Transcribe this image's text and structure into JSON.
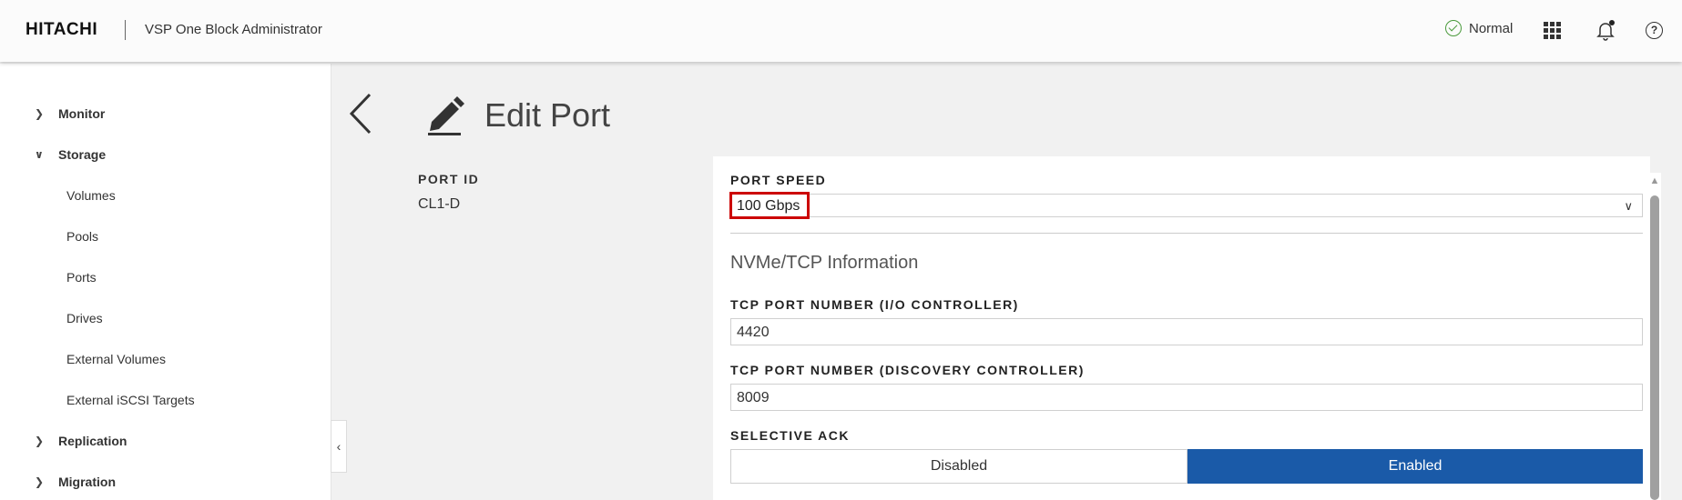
{
  "header": {
    "logo": "HITACHI",
    "app_title": "VSP One Block Administrator",
    "status": "Normal",
    "status_color": "#4a9a3c"
  },
  "sidebar": {
    "items": [
      {
        "label": "Monitor",
        "expanded": false
      },
      {
        "label": "Storage",
        "expanded": true
      },
      {
        "label": "Volumes"
      },
      {
        "label": "Pools"
      },
      {
        "label": "Ports"
      },
      {
        "label": "Drives"
      },
      {
        "label": "External Volumes"
      },
      {
        "label": "External iSCSI Targets"
      },
      {
        "label": "Replication",
        "expanded": false
      },
      {
        "label": "Migration",
        "expanded": false
      }
    ]
  },
  "page": {
    "title": "Edit Port"
  },
  "port": {
    "id_label": "PORT ID",
    "id_value": "CL1-D"
  },
  "form": {
    "port_speed_label": "PORT SPEED",
    "port_speed_value": "100 Gbps",
    "section_title": "NVMe/TCP Information",
    "tcp_io_label": "TCP PORT NUMBER (I/O CONTROLLER)",
    "tcp_io_value": "4420",
    "tcp_discovery_label": "TCP PORT NUMBER (DISCOVERY CONTROLLER)",
    "tcp_discovery_value": "8009",
    "selective_ack_label": "SELECTIVE ACK",
    "selective_ack_options": [
      "Disabled",
      "Enabled"
    ],
    "selective_ack_selected": "Enabled"
  },
  "colors": {
    "accent": "#1a5aa8",
    "highlight": "#cc0000"
  }
}
